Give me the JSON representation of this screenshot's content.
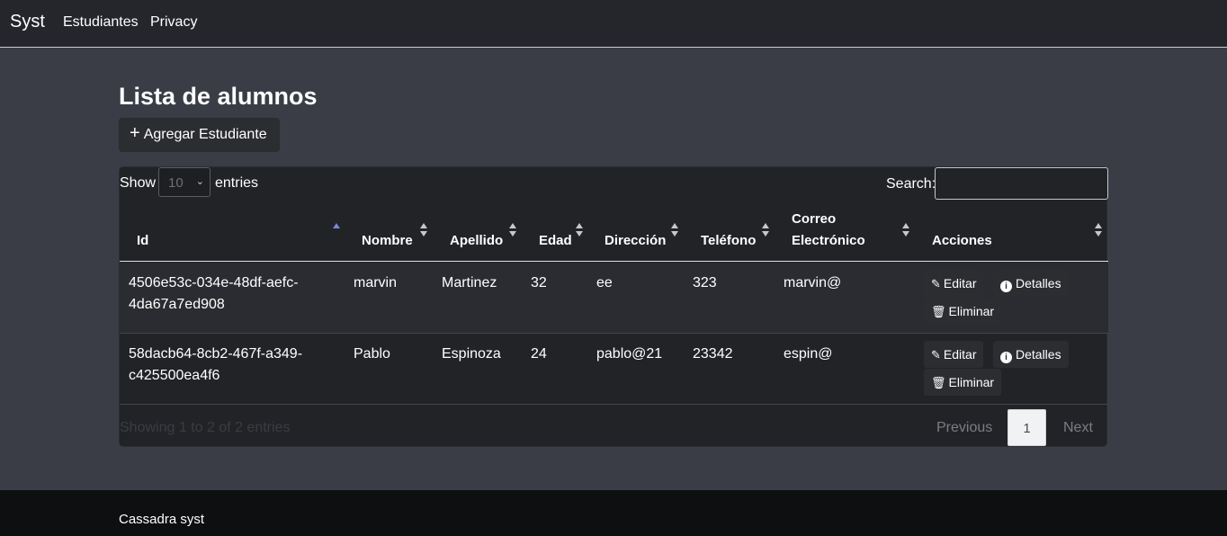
{
  "navbar": {
    "brand": "Syst",
    "links": [
      "Estudiantes",
      "Privacy"
    ]
  },
  "page": {
    "title": "Lista de alumnos",
    "add_button": "Agregar Estudiante"
  },
  "table_controls": {
    "show_label": "Show",
    "length_value": "10",
    "entries_label": "entries",
    "search_label": "Search:",
    "search_value": ""
  },
  "table": {
    "columns": [
      "Id",
      "Nombre",
      "Apellido",
      "Edad",
      "Dirección",
      "Teléfono",
      "Correo",
      "Electrónico",
      "Acciones"
    ],
    "rows": [
      {
        "id_line1": "4506e53c-034e-48df-aefc-",
        "id_line2": "4da67a7ed908",
        "nombre": "marvin",
        "apellido": "Martinez",
        "edad": "32",
        "direccion": "ee",
        "telefono": "323",
        "correo": "marvin@"
      },
      {
        "id_line1": "58dacb64-8cb2-467f-a349-",
        "id_line2": "c425500ea4f6",
        "nombre": "Pablo",
        "apellido": "Espinoza",
        "edad": "24",
        "direccion": "pablo@21",
        "telefono": "23342",
        "correo": "espin@"
      }
    ],
    "actions": {
      "edit": "Editar",
      "details": "Detalles",
      "delete": "Eliminar"
    }
  },
  "pagination": {
    "info": "Showing 1 to 2 of 2 entries",
    "previous": "Previous",
    "current_page": "1",
    "next": "Next"
  },
  "footer": {
    "text": "Cassadra syst"
  },
  "colors": {
    "page_bg": "#3a3d46",
    "navbar_bg": "#24262c",
    "panel_bg": "#212327",
    "sort_active": "#7c86d6"
  }
}
